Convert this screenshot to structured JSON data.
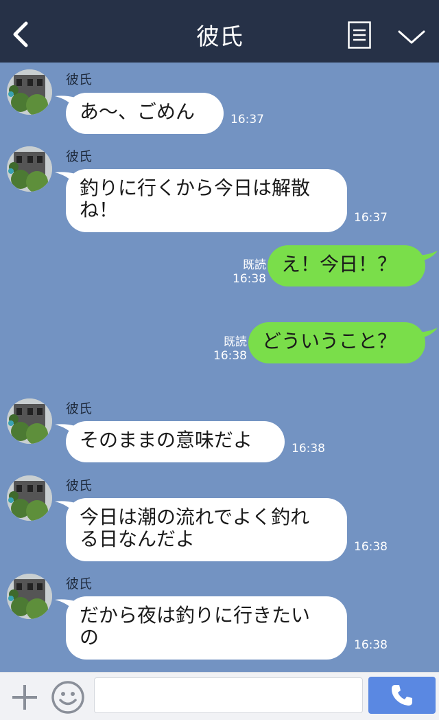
{
  "header": {
    "title": "彼氏"
  },
  "messages": [
    {
      "sender": "彼氏",
      "text": "あ〜、ごめん",
      "time": "16:37"
    },
    {
      "sender": "彼氏",
      "text": "釣りに行くから今日は解散\nね！",
      "time": "16:37"
    },
    {
      "read": "既読",
      "text": "え！今日！？",
      "time": "16:38"
    },
    {
      "read": "既読",
      "text": "どういうこと？",
      "time": "16:38"
    },
    {
      "sender": "彼氏",
      "text": "そのままの意味だよ",
      "time": "16:38"
    },
    {
      "sender": "彼氏",
      "text": "今日は潮の流れでよく釣れ\nる日なんだよ",
      "time": "16:38"
    },
    {
      "sender": "彼氏",
      "text": "だから夜は釣りに行きたい\nの",
      "time": "16:38"
    }
  ],
  "footer": {
    "input_placeholder": ""
  },
  "colors": {
    "header_bg": "#263147",
    "chat_bg": "#7393c2",
    "incoming_bubble": "#ffffff",
    "outgoing_bubble": "#7ade4a",
    "call_button": "#5a88e2"
  },
  "icons": [
    "back-chevron-icon",
    "menu-icon",
    "chevron-down-icon",
    "plus-icon",
    "smiley-icon",
    "phone-icon"
  ]
}
